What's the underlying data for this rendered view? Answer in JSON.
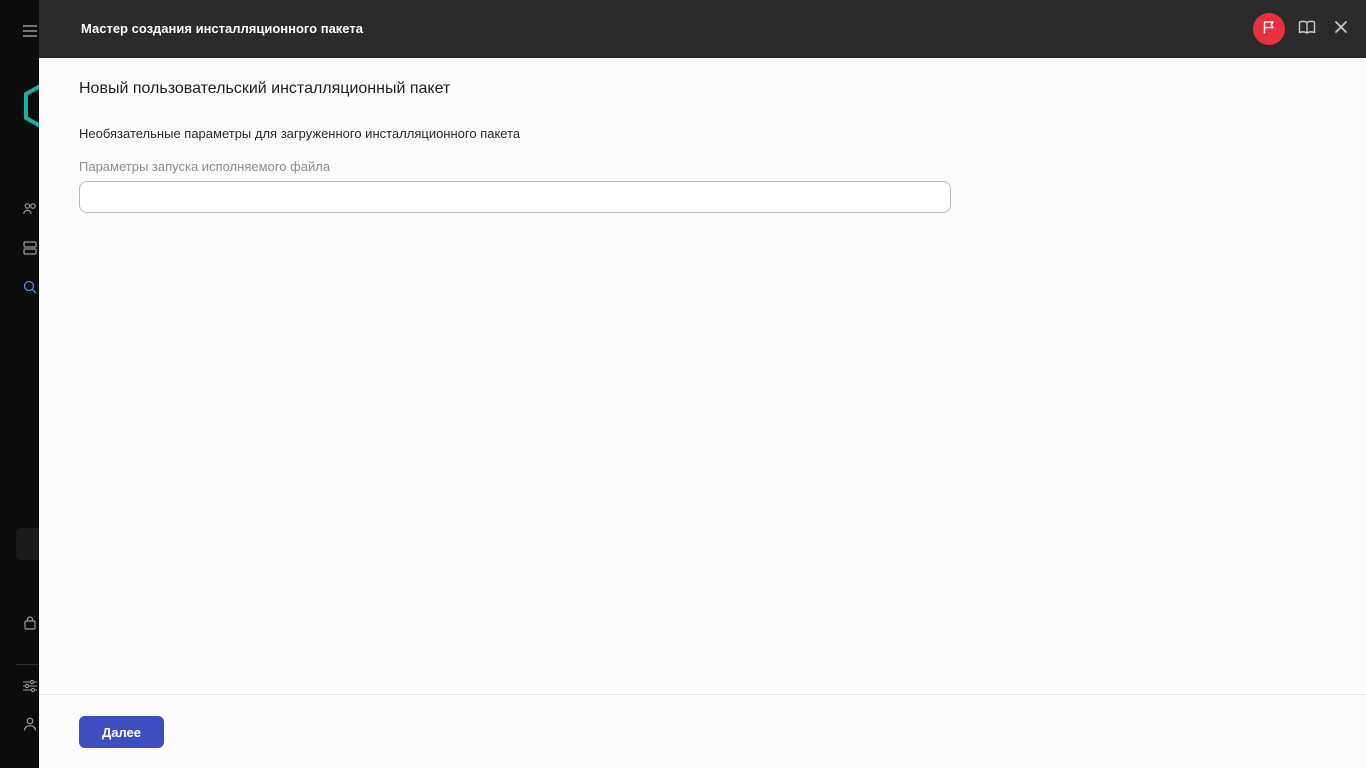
{
  "dialog": {
    "title": "Мастер создания инсталляционного пакета",
    "heading": "Новый пользовательский инсталляционный пакет",
    "section_label": "Необязательные параметры для загруженного инсталляционного пакета",
    "field": {
      "label": "Параметры запуска исполняемого файла",
      "value": "",
      "placeholder": ""
    },
    "next_button_label": "Далее",
    "header_icons": [
      "flag-icon",
      "book-icon",
      "close-icon"
    ]
  },
  "sidebar": {
    "icons": [
      "menu-icon",
      "logo-icon",
      "users-icon",
      "database-icon",
      "search-icon",
      "bag-icon",
      "settings-sliders-icon",
      "user-icon"
    ]
  },
  "colors": {
    "header_bg": "#2b2b2b",
    "flag_button": "#e8313f",
    "primary_button": "#3d4fbe",
    "logo_accent": "#16b39a"
  }
}
